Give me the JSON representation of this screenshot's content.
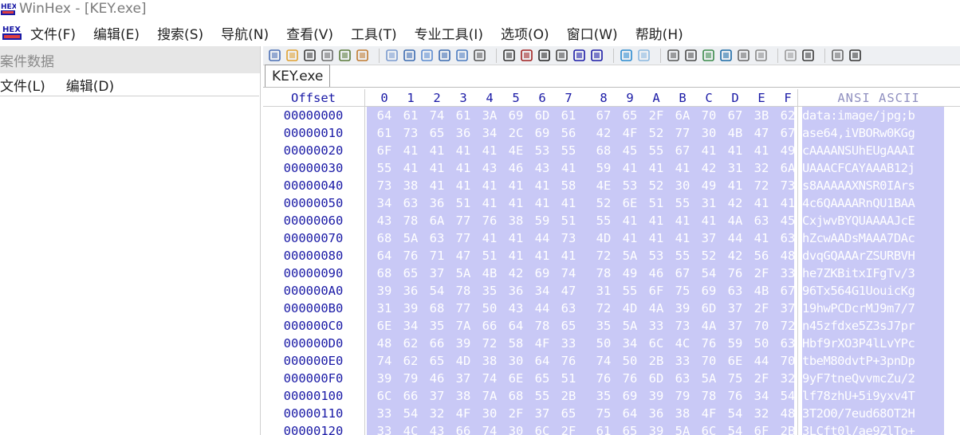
{
  "window": {
    "title": "WinHex - [KEY.exe]"
  },
  "menu": {
    "items": [
      "文件(F)",
      "编辑(E)",
      "搜索(S)",
      "导航(N)",
      "查看(V)",
      "工具(T)",
      "专业工具(I)",
      "选项(O)",
      "窗口(W)",
      "帮助(H)"
    ]
  },
  "case_panel": {
    "header": "案件数据",
    "menu_file": "文件(L)",
    "menu_edit": "编辑(D)"
  },
  "tab": {
    "label": "KEY.exe"
  },
  "hex_header": {
    "offset_label": "Offset",
    "columns": [
      "0",
      "1",
      "2",
      "3",
      "4",
      "5",
      "6",
      "7",
      "8",
      "9",
      "A",
      "B",
      "C",
      "D",
      "E",
      "F"
    ],
    "ansi_label": "ANSI ASCII"
  },
  "rows": [
    {
      "offset": "00000000",
      "bytes": [
        "64",
        "61",
        "74",
        "61",
        "3A",
        "69",
        "6D",
        "61",
        "67",
        "65",
        "2F",
        "6A",
        "70",
        "67",
        "3B",
        "62"
      ],
      "ascii": "data:image/jpg;b"
    },
    {
      "offset": "00000010",
      "bytes": [
        "61",
        "73",
        "65",
        "36",
        "34",
        "2C",
        "69",
        "56",
        "42",
        "4F",
        "52",
        "77",
        "30",
        "4B",
        "47",
        "67"
      ],
      "ascii": "ase64,iVBORw0KGg"
    },
    {
      "offset": "00000020",
      "bytes": [
        "6F",
        "41",
        "41",
        "41",
        "41",
        "4E",
        "53",
        "55",
        "68",
        "45",
        "55",
        "67",
        "41",
        "41",
        "41",
        "49"
      ],
      "ascii": "cAAAANSUhEUgAAAI"
    },
    {
      "offset": "00000030",
      "bytes": [
        "55",
        "41",
        "41",
        "41",
        "43",
        "46",
        "43",
        "41",
        "59",
        "41",
        "41",
        "41",
        "42",
        "31",
        "32",
        "6A"
      ],
      "ascii": "UAAACFCAYAAAB12j"
    },
    {
      "offset": "00000040",
      "bytes": [
        "73",
        "38",
        "41",
        "41",
        "41",
        "41",
        "41",
        "58",
        "4E",
        "53",
        "52",
        "30",
        "49",
        "41",
        "72",
        "73"
      ],
      "ascii": "s8AAAAAXNSR0IArs"
    },
    {
      "offset": "00000050",
      "bytes": [
        "34",
        "63",
        "36",
        "51",
        "41",
        "41",
        "41",
        "41",
        "52",
        "6E",
        "51",
        "55",
        "31",
        "42",
        "41",
        "41"
      ],
      "ascii": "4c6QAAAARnQU1BAA"
    },
    {
      "offset": "00000060",
      "bytes": [
        "43",
        "78",
        "6A",
        "77",
        "76",
        "38",
        "59",
        "51",
        "55",
        "41",
        "41",
        "41",
        "41",
        "4A",
        "63",
        "45"
      ],
      "ascii": "CxjwvBYQUAAAAJcE"
    },
    {
      "offset": "00000070",
      "bytes": [
        "68",
        "5A",
        "63",
        "77",
        "41",
        "41",
        "44",
        "73",
        "4D",
        "41",
        "41",
        "41",
        "37",
        "44",
        "41",
        "63"
      ],
      "ascii": "hZcwAADsMAAA7DAc"
    },
    {
      "offset": "00000080",
      "bytes": [
        "64",
        "76",
        "71",
        "47",
        "51",
        "41",
        "41",
        "41",
        "72",
        "5A",
        "53",
        "55",
        "52",
        "42",
        "56",
        "48"
      ],
      "ascii": "dvqGQAAArZSURBVH"
    },
    {
      "offset": "00000090",
      "bytes": [
        "68",
        "65",
        "37",
        "5A",
        "4B",
        "42",
        "69",
        "74",
        "78",
        "49",
        "46",
        "67",
        "54",
        "76",
        "2F",
        "33"
      ],
      "ascii": "he7ZKBitxIFgTv/3"
    },
    {
      "offset": "000000A0",
      "bytes": [
        "39",
        "36",
        "54",
        "78",
        "35",
        "36",
        "34",
        "47",
        "31",
        "55",
        "6F",
        "75",
        "69",
        "63",
        "4B",
        "67"
      ],
      "ascii": "96Tx564G1UouicKg"
    },
    {
      "offset": "000000B0",
      "bytes": [
        "31",
        "39",
        "68",
        "77",
        "50",
        "43",
        "44",
        "63",
        "72",
        "4D",
        "4A",
        "39",
        "6D",
        "37",
        "2F",
        "37"
      ],
      "ascii": "19hwPCDcrMJ9m7/7"
    },
    {
      "offset": "000000C0",
      "bytes": [
        "6E",
        "34",
        "35",
        "7A",
        "66",
        "64",
        "78",
        "65",
        "35",
        "5A",
        "33",
        "73",
        "4A",
        "37",
        "70",
        "72"
      ],
      "ascii": "n45zfdxe5Z3sJ7pr"
    },
    {
      "offset": "000000D0",
      "bytes": [
        "48",
        "62",
        "66",
        "39",
        "72",
        "58",
        "4F",
        "33",
        "50",
        "34",
        "6C",
        "4C",
        "76",
        "59",
        "50",
        "63"
      ],
      "ascii": "Hbf9rXO3P4lLvYPc"
    },
    {
      "offset": "000000E0",
      "bytes": [
        "74",
        "62",
        "65",
        "4D",
        "38",
        "30",
        "64",
        "76",
        "74",
        "50",
        "2B",
        "33",
        "70",
        "6E",
        "44",
        "70"
      ],
      "ascii": "tbeM80dvtP+3pnDp"
    },
    {
      "offset": "000000F0",
      "bytes": [
        "39",
        "79",
        "46",
        "37",
        "74",
        "6E",
        "65",
        "51",
        "76",
        "76",
        "6D",
        "63",
        "5A",
        "75",
        "2F",
        "32"
      ],
      "ascii": "9yF7tneQvvmcZu/2"
    },
    {
      "offset": "00000100",
      "bytes": [
        "6C",
        "66",
        "37",
        "38",
        "7A",
        "68",
        "55",
        "2B",
        "35",
        "69",
        "39",
        "79",
        "78",
        "76",
        "34",
        "54"
      ],
      "ascii": "lf78zhU+5i9yxv4T"
    },
    {
      "offset": "00000110",
      "bytes": [
        "33",
        "54",
        "32",
        "4F",
        "30",
        "2F",
        "37",
        "65",
        "75",
        "64",
        "36",
        "38",
        "4F",
        "54",
        "32",
        "48"
      ],
      "ascii": "3T2O0/7eud68OT2H"
    },
    {
      "offset": "00000120",
      "bytes": [
        "33",
        "4C",
        "43",
        "66",
        "74",
        "30",
        "6C",
        "2F",
        "61",
        "65",
        "39",
        "5A",
        "6C",
        "54",
        "6F",
        "2B"
      ],
      "ascii": "3LCft0l/ae9ZlTo+"
    }
  ],
  "colors": {
    "selection": "#c9c9f6",
    "offset_text": "#1a1aa6",
    "selected_text": "#ffffff"
  },
  "icons": {
    "app": "winhex-app-icon",
    "toolbar": [
      "new-file-icon",
      "open-folder-icon",
      "save-icon",
      "print-icon",
      "properties-icon",
      "export-icon",
      "undo-icon",
      "copy-icon",
      "cut-icon",
      "paste-icon",
      "paste-special-icon",
      "hex-convert-icon",
      "find-text-icon",
      "find-hex-icon",
      "replace-text-icon",
      "replace-hex-icon",
      "goto-offset-icon",
      "goto-sector-icon",
      "back-icon",
      "forward-icon",
      "disk-icon",
      "disk-2-icon",
      "ram-icon",
      "calculator-icon",
      "search-icon",
      "clone-icon",
      "hash-icon",
      "settings-icon",
      "window-icon",
      "drive-icon"
    ]
  }
}
